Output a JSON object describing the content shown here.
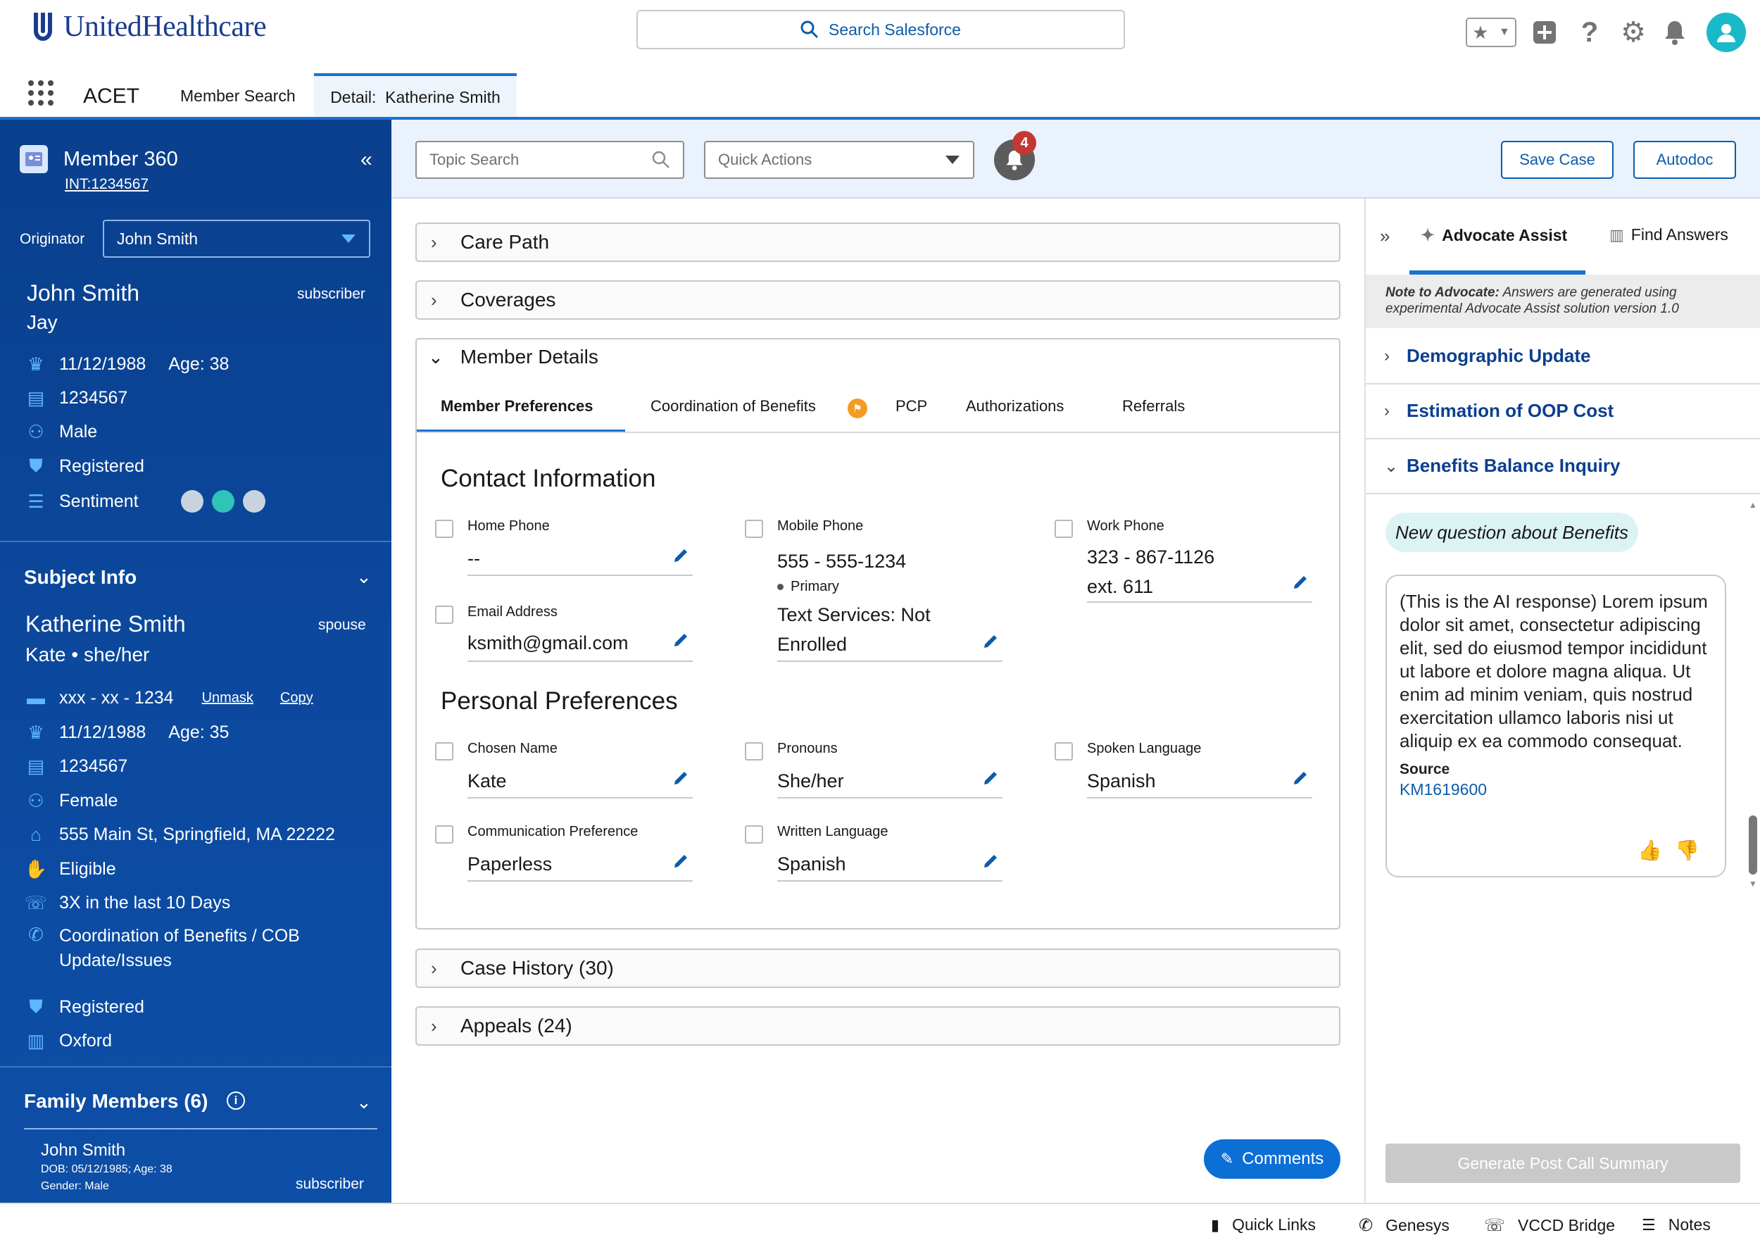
{
  "header": {
    "brand": "UnitedHealthcare",
    "search_placeholder": "Search Salesforce"
  },
  "nav": {
    "app_name": "ACET",
    "tabs": [
      {
        "label": "Member Search"
      },
      {
        "label": "Detail:  Katherine Smith"
      }
    ]
  },
  "member360": {
    "title": "Member 360",
    "id": "INT:1234567",
    "originator_label": "Originator",
    "originator_value": "John Smith",
    "subscriber": {
      "name": "John Smith",
      "role": "subscriber",
      "nickname": "Jay",
      "dob": "11/12/1988",
      "age": "Age: 38",
      "member_id": "1234567",
      "gender": "Male",
      "status": "Registered",
      "sentiment_label": "Sentiment"
    }
  },
  "subject": {
    "section_title": "Subject Info",
    "name": "Katherine Smith",
    "role": "spouse",
    "subtitle": "Kate • she/her",
    "ssn": "xxx - xx - 1234",
    "unmask": "Unmask",
    "copy": "Copy",
    "dob": "11/12/1988",
    "age": "Age: 35",
    "member_id": "1234567",
    "gender": "Female",
    "address": "555 Main St, Springfield, MA 22222",
    "eligibility": "Eligible",
    "calls": "3X in the last 10 Days",
    "cob_line1": "Coordination of Benefits / COB",
    "cob_line2": "Update/Issues",
    "registration": "Registered",
    "network": "Oxford"
  },
  "family": {
    "title": "Family Members (6)",
    "member": {
      "name": "John Smith",
      "dob": "DOB: 05/12/1985; Age: 38",
      "gender": "Gender: Male",
      "role": "subscriber"
    }
  },
  "toolbar": {
    "topic_placeholder": "Topic Search",
    "quick_actions": "Quick Actions",
    "notification_count": "4",
    "save_case": "Save Case",
    "autodoc": "Autodoc"
  },
  "sections": {
    "care_path": "Care Path",
    "coverages": "Coverages",
    "member_details": "Member Details",
    "case_history": "Case History (30)",
    "appeals": "Appeals (24)"
  },
  "member_details": {
    "tabs": [
      "Member Preferences",
      "Coordination of Benefits",
      "PCP",
      "Authorizations",
      "Referrals"
    ],
    "contact_heading": "Contact Information",
    "home_phone_label": "Home Phone",
    "home_phone_value": "--",
    "mobile_phone_label": "Mobile Phone",
    "mobile_phone_value": "555 - 555-1234",
    "mobile_primary": "Primary",
    "text_services_line1": "Text Services: Not",
    "text_services_line2": "Enrolled",
    "work_phone_label": "Work Phone",
    "work_phone_value": "323 - 867-1126",
    "work_phone_ext": "ext. 611",
    "email_label": "Email Address",
    "email_value": "ksmith@gmail.com",
    "personal_heading": "Personal Preferences",
    "chosen_name_label": "Chosen Name",
    "chosen_name_value": "Kate",
    "pronouns_label": "Pronouns",
    "pronouns_value": "She/her",
    "spoken_language_label": "Spoken Language",
    "spoken_language_value": "Spanish",
    "comm_pref_label": "Communication Preference",
    "comm_pref_value": "Paperless",
    "written_language_label": "Written Language",
    "written_language_value": "Spanish"
  },
  "comments_button": "Comments",
  "assist": {
    "tab_advocate": "Advocate Assist",
    "tab_find": "Find Answers",
    "note_prefix": "Note to Advocate:",
    "note_line1": " Answers are generated using",
    "note_line2": "experimental Advocate Assist solution version 1.0",
    "items": [
      "Demographic Update",
      "Estimation of OOP Cost",
      "Benefits Balance Inquiry"
    ],
    "question": "New question about Benefits",
    "response": "(This is the AI response) Lorem ipsum dolor sit amet, consectetur adipiscing elit, sed do eiusmod tempor incididunt ut labore et dolore magna aliqua. Ut enim ad minim veniam, quis nostrud exercitation ullamco laboris nisi ut aliquip ex ea commodo consequat.",
    "source_label": "Source",
    "source_link": "KM1619600",
    "generate_button": "Generate Post Call Summary"
  },
  "footer": {
    "items": [
      "Quick Links",
      "Genesys",
      "VCCD Bridge",
      "Notes"
    ]
  },
  "colors": {
    "brand_blue": "#1b3c8f",
    "panel_blue": "#0a3f8d",
    "accent": "#0b5cab",
    "badge_red": "#c23934"
  }
}
